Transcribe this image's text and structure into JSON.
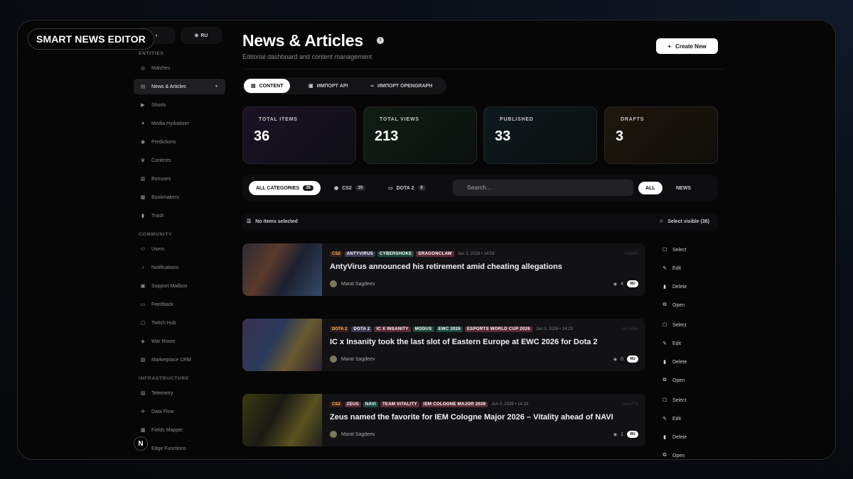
{
  "brand": "SMART NEWS EDITOR",
  "topbar": {
    "theme_icon": "moon-icon",
    "lang_label": "RU"
  },
  "sidebar": {
    "sections": [
      {
        "label": "ENTITIES",
        "items": [
          {
            "label": "Matches",
            "icon": "ball-icon"
          },
          {
            "label": "News & Articles",
            "icon": "newspaper-icon",
            "active": true
          },
          {
            "label": "Shorts",
            "icon": "play-icon"
          },
          {
            "label": "Media Hydratizer",
            "icon": "sparkle-icon"
          },
          {
            "label": "Predictions",
            "icon": "target-icon"
          },
          {
            "label": "Contests",
            "icon": "trophy-icon"
          },
          {
            "label": "Bonuses",
            "icon": "gift-icon"
          },
          {
            "label": "Bookmakers",
            "icon": "book-icon"
          },
          {
            "label": "Trash",
            "icon": "trash-icon"
          }
        ]
      },
      {
        "label": "COMMUNITY",
        "items": [
          {
            "label": "Users",
            "icon": "users-icon"
          },
          {
            "label": "Notifications",
            "icon": "bell-icon"
          },
          {
            "label": "Support Mailbox",
            "icon": "mailbox-icon"
          },
          {
            "label": "Feedback",
            "icon": "message-icon"
          },
          {
            "label": "Twitch Hub",
            "icon": "tv-icon"
          },
          {
            "label": "War Room",
            "icon": "gamepad-icon"
          },
          {
            "label": "Marketplace CRM",
            "icon": "store-icon"
          }
        ]
      },
      {
        "label": "INFRASTRUCTURE",
        "items": [
          {
            "label": "Telemetry",
            "icon": "chart-icon"
          },
          {
            "label": "Data Flow",
            "icon": "flow-icon"
          },
          {
            "label": "Fields Mapper",
            "icon": "map-icon"
          },
          {
            "label": "Edge Functions",
            "icon": "function-icon"
          }
        ]
      }
    ]
  },
  "header": {
    "title": "News & Articles",
    "subtitle": "Editorial dashboard and content management",
    "create_label": "Create New"
  },
  "tabs": [
    {
      "label": "CONTENT",
      "active": true
    },
    {
      "label": "ИМПОРТ API"
    },
    {
      "label": "ИМПОРТ OPENGRAPH"
    }
  ],
  "stats": [
    {
      "label": "TOTAL ITEMS",
      "value": "36",
      "accent": "#1a1024"
    },
    {
      "label": "TOTAL VIEWS",
      "value": "213",
      "accent": "#0d1a12"
    },
    {
      "label": "PUBLISHED",
      "value": "33",
      "accent": "#0c1618"
    },
    {
      "label": "DRAFTS",
      "value": "3",
      "accent": "#1a140a"
    }
  ],
  "filters": {
    "categories": [
      {
        "label": "ALL CATEGORIES",
        "count": "36",
        "active": true
      },
      {
        "label": "CS2",
        "count": "20"
      },
      {
        "label": "DOTA 2",
        "count": "8"
      }
    ],
    "search_placeholder": "Search...",
    "types": [
      {
        "label": "ALL",
        "active": true
      },
      {
        "label": "NEWS"
      }
    ]
  },
  "selection": {
    "status": "No items selected",
    "select_visible": "Select visible (36)"
  },
  "articles": [
    {
      "game": "CS2",
      "tags": [
        {
          "label": "ANTYVIRUS",
          "color": "#3a3a52"
        },
        {
          "label": "CYBERSHOKE",
          "color": "#1f4a3a"
        },
        {
          "label": "DRAGONCLAW",
          "color": "#5a2a36"
        }
      ],
      "date": "Jun 3, 2026 • 14:59",
      "id": "#cbe42",
      "title": "AntyVirus announced his retirement amid cheating allegations",
      "author": "Marat Sagdeev",
      "views": "4",
      "lang": "RU"
    },
    {
      "game": "DOTA 2",
      "tags": [
        {
          "label": "DOTA 2",
          "color": "#3a3a52"
        },
        {
          "label": "IC X INSANITY",
          "color": "#5a2a36"
        },
        {
          "label": "MODUS",
          "color": "#1f4a3a"
        },
        {
          "label": "EWC 2026",
          "color": "#1f4a44"
        },
        {
          "label": "ESPORTS WORLD CUP 2026",
          "color": "#5a2a36"
        }
      ],
      "date": "Jun 3, 2026 • 14:29",
      "id": "#e7da6e",
      "title": "IC x Insanity took the last slot of Eastern Europe at EWC 2026 for Dota 2",
      "author": "Marat Sagdeev",
      "views": "0",
      "lang": "RU"
    },
    {
      "game": "CS2",
      "tags": [
        {
          "label": "ZEUS",
          "color": "#5a2a36"
        },
        {
          "label": "NAVI",
          "color": "#1f4a44"
        },
        {
          "label": "TEAM VITALITY",
          "color": "#5a2a36"
        },
        {
          "label": "IEM COLOGNE MAJOR 2026",
          "color": "#5a2a36"
        }
      ],
      "date": "Jun 3, 2026 • 14:19",
      "id": "#eea77e",
      "title": "Zeus named the favorite for IEM Cologne Major 2026 – Vitality ahead of NAVI",
      "author": "Marat Sagdeev",
      "views": "1",
      "lang": "RU"
    }
  ],
  "row_actions": [
    "Select",
    "Edit",
    "Delete",
    "Open"
  ]
}
